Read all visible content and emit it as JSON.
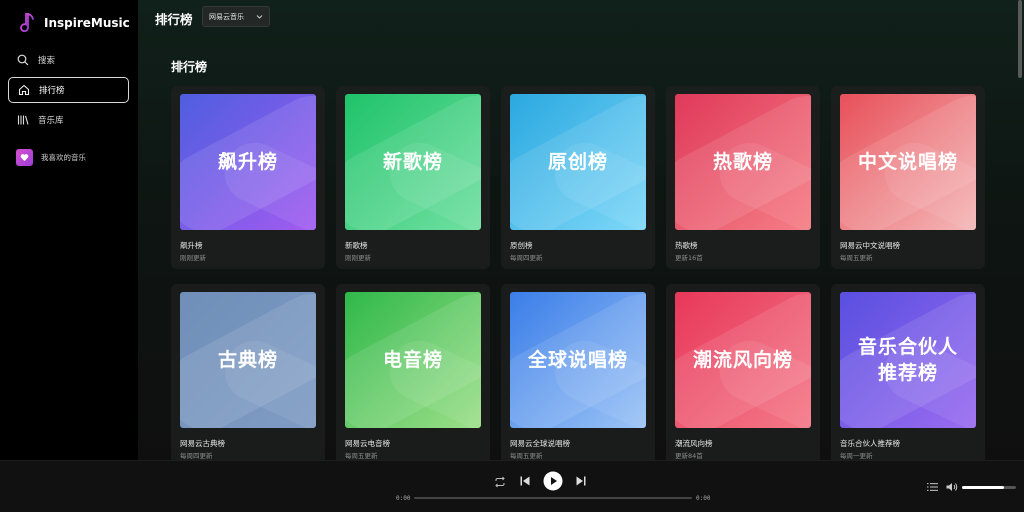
{
  "app": {
    "name": "InspireMusic"
  },
  "sidebar": {
    "items": [
      {
        "label": "搜索",
        "icon": "search-icon",
        "active": false
      },
      {
        "label": "排行榜",
        "icon": "home-icon",
        "active": true
      },
      {
        "label": "音乐库",
        "icon": "library-icon",
        "active": false
      }
    ],
    "favorites": {
      "label": "我喜欢的音乐",
      "icon": "heart-icon"
    }
  },
  "header": {
    "title": "排行榜",
    "source_select": {
      "value": "网易云音乐"
    }
  },
  "main": {
    "section_title": "排行榜",
    "charts": [
      {
        "cover_text": "飙升榜",
        "name": "飙升榜",
        "subtitle": "刚刚更新",
        "colors": [
          "#4f5ee0",
          "#a25cf0"
        ]
      },
      {
        "cover_text": "新歌榜",
        "name": "新歌榜",
        "subtitle": "刚刚更新",
        "colors": [
          "#1fc36a",
          "#72e0a2"
        ]
      },
      {
        "cover_text": "原创榜",
        "name": "原创榜",
        "subtitle": "每周四更新",
        "colors": [
          "#2aa8e0",
          "#7fd8f8"
        ]
      },
      {
        "cover_text": "热歌榜",
        "name": "热歌榜",
        "subtitle": "更新16首",
        "colors": [
          "#e03a5a",
          "#f57e86"
        ]
      },
      {
        "cover_text": "中文说唱榜",
        "name": "网易云中文说唱榜",
        "subtitle": "每周五更新",
        "colors": [
          "#e8505a",
          "#f4b8b8"
        ]
      },
      {
        "cover_text": "古典榜",
        "name": "网易云古典榜",
        "subtitle": "每周四更新",
        "colors": [
          "#6f8fb8",
          "#7f9cc4"
        ]
      },
      {
        "cover_text": "电音榜",
        "name": "网易云电音榜",
        "subtitle": "每周五更新",
        "colors": [
          "#2fb84a",
          "#9ee08a"
        ]
      },
      {
        "cover_text": "全球说唱榜",
        "name": "网易云全球说唱榜",
        "subtitle": "每周五更新",
        "colors": [
          "#3b7ee8",
          "#9cc4f6"
        ]
      },
      {
        "cover_text": "潮流风向榜",
        "name": "潮流风向榜",
        "subtitle": "更新84首",
        "colors": [
          "#e8385a",
          "#f47a88"
        ]
      },
      {
        "cover_text": "音乐合伙人\n推荐榜",
        "name": "音乐合伙人推荐榜",
        "subtitle": "每周一更新",
        "colors": [
          "#5a4fe0",
          "#9a6cf0"
        ]
      }
    ]
  },
  "player": {
    "current_time": "0:00",
    "total_time": "0:00",
    "progress": 0,
    "volume": 0.78
  }
}
